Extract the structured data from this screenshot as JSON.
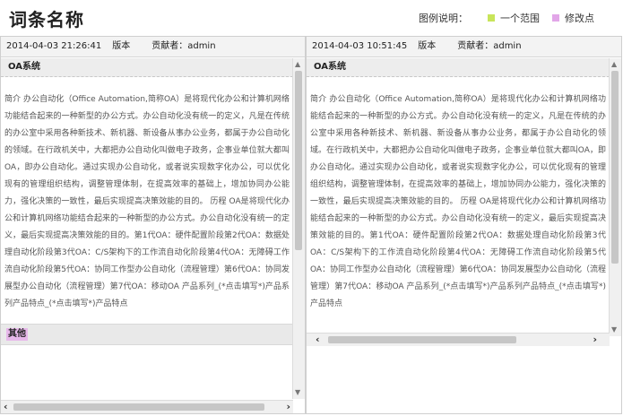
{
  "header": {
    "title": "词条名称",
    "legend_label": "图例说明：",
    "legend_items": [
      {
        "label": "一个范围",
        "color": "#c8e55a"
      },
      {
        "label": "修改点",
        "color": "#e2a6e8"
      }
    ]
  },
  "left": {
    "date": "2014-04-03 21:26:41",
    "version": "版本",
    "contributor": "贡献者：admin",
    "section_title": "OA系统",
    "body": "简介 办公自动化（Office Automation,简称OA）是将现代化办公和计算机网络功能结合起来的一种新型的办公方式。办公自动化没有统一的定义，凡是在传统的办公室中采用各种新技术、新机器、新设备从事办公业务，都属于办公自动化的领域。在行政机关中，大都把办公自动化叫做电子政务，企事业单位就大都叫OA，即办公自动化。通过实现办公自动化，或者说实现数字化办公，可以优化现有的管理组织结构，调整管理体制，在提高效率的基础上，增加协同办公能力，强化决策的一致性，最后实现提高决策效能的目的。 历程 OA是将现代化办公和计算机网络功能结合起来的一种新型的办公方式。办公自动化没有统一的定义，最后实现提高决策效能的目的。第1代OA：硬件配置阶段第2代OA：数据处理自动化阶段第3代OA：C/S架构下的工作流自动化阶段第4代OA：无障碍工作流自动化阶段第5代OA：协同工作型办公自动化（流程管理）第6代OA：协同发展型办公自动化（流程管理）第7代OA：移动OA 产品系列_(*点击填写*)产品系列产品特点_(*点击填写*)产品特点",
    "other_label": "其他"
  },
  "right": {
    "date": "2014-04-03 10:51:45",
    "version": "版本",
    "contributor": "贡献者：admin",
    "section_title": "OA系统",
    "body": "简介 办公自动化（Office Automation,简称OA）是将现代化办公和计算机网络功能结合起来的一种新型的办公方式。办公自动化没有统一的定义，凡是在传统的办公室中采用各种新技术、新机器、新设备从事办公业务，都属于办公自动化的领域。在行政机关中，大都把办公自动化叫做电子政务，企事业单位就大都叫OA，即办公自动化。通过实现办公自动化，或者说实现数字化办公，可以优化现有的管理组织结构，调整管理体制，在提高效率的基础上，增加协同办公能力，强化决策的一致性，最后实现提高决策效能的目的。 历程 OA是将现代化办公和计算机网络功能结合起来的一种新型的办公方式。办公自动化没有统一的定义，最后实现提高决策效能的目的。第1代OA：硬件配置阶段第2代OA：数据处理自动化阶段第3代OA：C/S架构下的工作流自动化阶段第4代OA：无障碍工作流自动化阶段第5代OA：协同工作型办公自动化（流程管理）第6代OA：协同发展型办公自动化（流程管理）第7代OA：移动OA 产品系列_(*点击填写*)产品系列产品特点_(*点击填写*)产品特点"
  }
}
